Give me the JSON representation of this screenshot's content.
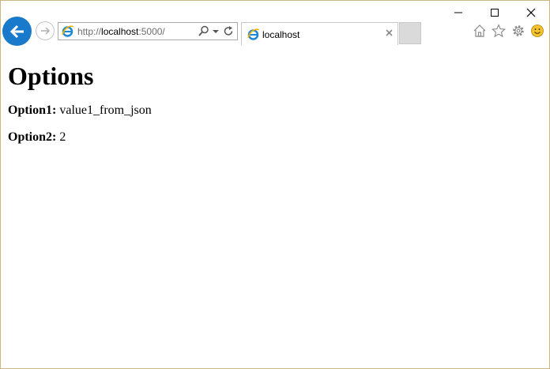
{
  "browser": {
    "address_scheme": "http://",
    "address_host": "localhost",
    "address_rest": ":5000/",
    "tab_title": "localhost",
    "icons": {
      "back": "back-arrow-icon",
      "forward": "forward-arrow-icon",
      "site": "ie-icon",
      "search": "search-icon",
      "dropdown": "dropdown-icon",
      "refresh": "refresh-icon",
      "tab_close": "close-icon",
      "home": "home-icon",
      "favorites": "star-icon",
      "tools": "gear-icon",
      "feedback": "smiley-icon",
      "minimize": "minimize-icon",
      "maximize": "maximize-icon",
      "close": "close-icon"
    },
    "colors": {
      "back_button": "#1979ca",
      "window_border": "#c9b783",
      "smiley": "#f3c22f"
    }
  },
  "page": {
    "title": "Options",
    "options": [
      {
        "label": "Option1:",
        "value": "value1_from_json"
      },
      {
        "label": "Option2:",
        "value": "2"
      }
    ]
  }
}
